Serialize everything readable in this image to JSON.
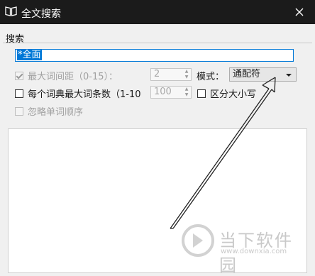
{
  "window": {
    "title": "全文搜索"
  },
  "search_group": {
    "label": "搜索",
    "query_value": "*全面"
  },
  "options": {
    "max_distance": {
      "label": "最大词间距（0-15）：",
      "value": "2",
      "checked": true,
      "enabled": false
    },
    "mode": {
      "label": "模式：",
      "selected": "通配符"
    },
    "max_entries": {
      "label": "每个词典最大词条数（1-10",
      "value": "100",
      "checked": false
    },
    "case_sensitive": {
      "label": "区分大小写",
      "checked": false
    },
    "ignore_order": {
      "label": "忽略单词顺序",
      "checked": false,
      "enabled": false
    }
  },
  "watermark": {
    "name": "当下软件园",
    "url": "www.downxia.com"
  },
  "colors": {
    "titlebar": "#1b1b1b",
    "accent": "#0078d7",
    "window_bg": "#f0f0f0"
  },
  "icons": {
    "title": "book-icon",
    "close": "close-icon",
    "dropdown": "chevron-down-icon"
  }
}
